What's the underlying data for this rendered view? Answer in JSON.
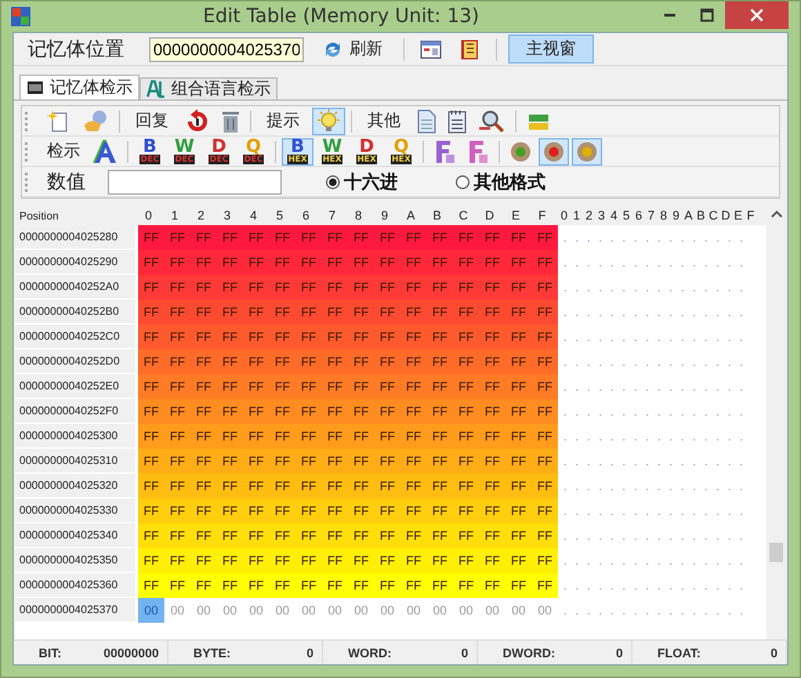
{
  "window": {
    "title": "Edit Table (Memory Unit: 13)"
  },
  "address_bar": {
    "label": "记忆体位置",
    "value": "0000000004025370",
    "refresh": "刷新",
    "main_view": {
      "label": "主视窗",
      "selected": true
    }
  },
  "tabs": [
    {
      "label": "记忆体检示",
      "selected": true
    },
    {
      "label": "组合语言检示",
      "selected": false
    }
  ],
  "toolbar_1": {
    "restore": "回复",
    "hint": "提示",
    "hint_selected": true,
    "other": "其他"
  },
  "toolbar_2": {
    "label": "检示",
    "dec_buttons": [
      {
        "letter": "B",
        "tag": "DEC",
        "color": "#3050d0",
        "selected": false
      },
      {
        "letter": "W",
        "tag": "DEC",
        "color": "#30a040",
        "selected": false
      },
      {
        "letter": "D",
        "tag": "DEC",
        "color": "#d03030",
        "selected": false
      },
      {
        "letter": "Q",
        "tag": "DEC",
        "color": "#e0a000",
        "selected": false
      }
    ],
    "hex_buttons": [
      {
        "letter": "B",
        "tag": "HEX",
        "color": "#3050d0",
        "selected": true
      },
      {
        "letter": "W",
        "tag": "HEX",
        "color": "#30a040",
        "selected": false
      },
      {
        "letter": "D",
        "tag": "HEX",
        "color": "#d03030",
        "selected": false
      },
      {
        "letter": "Q",
        "tag": "HEX",
        "color": "#e0a000",
        "selected": false
      }
    ],
    "lights": [
      {
        "color": "#40a020",
        "selected": false
      },
      {
        "color": "#e02020",
        "selected": true
      },
      {
        "color": "#e0b000",
        "selected": true
      }
    ]
  },
  "value_row": {
    "label": "数值",
    "radios": [
      {
        "label": "十六进",
        "selected": true
      },
      {
        "label": "其他格式",
        "selected": false
      }
    ]
  },
  "grid": {
    "position_header": "Position",
    "hex_headers": [
      "0",
      "1",
      "2",
      "3",
      "4",
      "5",
      "6",
      "7",
      "8",
      "9",
      "A",
      "B",
      "C",
      "D",
      "E",
      "F"
    ],
    "ascii_headers": [
      "0",
      "1",
      "2",
      "3",
      "4",
      "5",
      "6",
      "7",
      "8",
      "9",
      "A",
      "B",
      "C",
      "D",
      "E",
      "F"
    ],
    "rows": [
      {
        "address": "0000000004025280",
        "color": "#ff1840",
        "cursor_at_start": false,
        "bytes": [
          "FF",
          "FF",
          "FF",
          "FF",
          "FF",
          "FF",
          "FF",
          "FF",
          "FF",
          "FF",
          "FF",
          "FF",
          "FF",
          "FF",
          "FF",
          "FF"
        ],
        "ascii": "................"
      },
      {
        "address": "0000000004025290",
        "color": "#ff283b",
        "cursor_at_start": false,
        "bytes": [
          "FF",
          "FF",
          "FF",
          "FF",
          "FF",
          "FF",
          "FF",
          "FF",
          "FF",
          "FF",
          "FF",
          "FF",
          "FF",
          "FF",
          "FF",
          "FF"
        ],
        "ascii": "................"
      },
      {
        "address": "00000000040252A0",
        "color": "#ff3937",
        "cursor_at_start": false,
        "bytes": [
          "FF",
          "FF",
          "FF",
          "FF",
          "FF",
          "FF",
          "FF",
          "FF",
          "FF",
          "FF",
          "FF",
          "FF",
          "FF",
          "FF",
          "FF",
          "FF"
        ],
        "ascii": "................"
      },
      {
        "address": "00000000040252B0",
        "color": "#ff4a32",
        "cursor_at_start": false,
        "bytes": [
          "FF",
          "FF",
          "FF",
          "FF",
          "FF",
          "FF",
          "FF",
          "FF",
          "FF",
          "FF",
          "FF",
          "FF",
          "FF",
          "FF",
          "FF",
          "FF"
        ],
        "ascii": "................"
      },
      {
        "address": "00000000040252C0",
        "color": "#ff5a2e",
        "cursor_at_start": false,
        "bytes": [
          "FF",
          "FF",
          "FF",
          "FF",
          "FF",
          "FF",
          "FF",
          "FF",
          "FF",
          "FF",
          "FF",
          "FF",
          "FF",
          "FF",
          "FF",
          "FF"
        ],
        "ascii": "................"
      },
      {
        "address": "00000000040252D0",
        "color": "#ff6b29",
        "cursor_at_start": false,
        "bytes": [
          "FF",
          "FF",
          "FF",
          "FF",
          "FF",
          "FF",
          "FF",
          "FF",
          "FF",
          "FF",
          "FF",
          "FF",
          "FF",
          "FF",
          "FF",
          "FF"
        ],
        "ascii": "................"
      },
      {
        "address": "00000000040252E0",
        "color": "#ff7b25",
        "cursor_at_start": false,
        "bytes": [
          "FF",
          "FF",
          "FF",
          "FF",
          "FF",
          "FF",
          "FF",
          "FF",
          "FF",
          "FF",
          "FF",
          "FF",
          "FF",
          "FF",
          "FF",
          "FF"
        ],
        "ascii": "................"
      },
      {
        "address": "00000000040252F0",
        "color": "#ff8c20",
        "cursor_at_start": false,
        "bytes": [
          "FF",
          "FF",
          "FF",
          "FF",
          "FF",
          "FF",
          "FF",
          "FF",
          "FF",
          "FF",
          "FF",
          "FF",
          "FF",
          "FF",
          "FF",
          "FF"
        ],
        "ascii": "................"
      },
      {
        "address": "0000000004025300",
        "color": "#ff9c1b",
        "cursor_at_start": false,
        "bytes": [
          "FF",
          "FF",
          "FF",
          "FF",
          "FF",
          "FF",
          "FF",
          "FF",
          "FF",
          "FF",
          "FF",
          "FF",
          "FF",
          "FF",
          "FF",
          "FF"
        ],
        "ascii": "................"
      },
      {
        "address": "0000000004025310",
        "color": "#ffad17",
        "cursor_at_start": false,
        "bytes": [
          "FF",
          "FF",
          "FF",
          "FF",
          "FF",
          "FF",
          "FF",
          "FF",
          "FF",
          "FF",
          "FF",
          "FF",
          "FF",
          "FF",
          "FF",
          "FF"
        ],
        "ascii": "................"
      },
      {
        "address": "0000000004025320",
        "color": "#ffbd12",
        "cursor_at_start": false,
        "bytes": [
          "FF",
          "FF",
          "FF",
          "FF",
          "FF",
          "FF",
          "FF",
          "FF",
          "FF",
          "FF",
          "FF",
          "FF",
          "FF",
          "FF",
          "FF",
          "FF"
        ],
        "ascii": "................"
      },
      {
        "address": "0000000004025330",
        "color": "#ffce0e",
        "cursor_at_start": false,
        "bytes": [
          "FF",
          "FF",
          "FF",
          "FF",
          "FF",
          "FF",
          "FF",
          "FF",
          "FF",
          "FF",
          "FF",
          "FF",
          "FF",
          "FF",
          "FF",
          "FF"
        ],
        "ascii": "................"
      },
      {
        "address": "0000000004025340",
        "color": "#ffde09",
        "cursor_at_start": false,
        "bytes": [
          "FF",
          "FF",
          "FF",
          "FF",
          "FF",
          "FF",
          "FF",
          "FF",
          "FF",
          "FF",
          "FF",
          "FF",
          "FF",
          "FF",
          "FF",
          "FF"
        ],
        "ascii": "................"
      },
      {
        "address": "0000000004025350",
        "color": "#ffef05",
        "cursor_at_start": false,
        "bytes": [
          "FF",
          "FF",
          "FF",
          "FF",
          "FF",
          "FF",
          "FF",
          "FF",
          "FF",
          "FF",
          "FF",
          "FF",
          "FF",
          "FF",
          "FF",
          "FF"
        ],
        "ascii": "................"
      },
      {
        "address": "0000000004025360",
        "color": "#ffff00",
        "cursor_at_start": false,
        "bytes": [
          "FF",
          "FF",
          "FF",
          "FF",
          "FF",
          "FF",
          "FF",
          "FF",
          "FF",
          "FF",
          "FF",
          "FF",
          "FF",
          "FF",
          "FF",
          "FF"
        ],
        "ascii": "................"
      },
      {
        "address": "0000000004025370",
        "cursor_at_start": true,
        "bytes": [
          "00",
          "00",
          "00",
          "00",
          "00",
          "00",
          "00",
          "00",
          "00",
          "00",
          "00",
          "00",
          "00",
          "00",
          "00",
          "00"
        ],
        "ascii": "................"
      }
    ]
  },
  "status_bar": [
    {
      "label": "BIT:",
      "value": "00000000"
    },
    {
      "label": "BYTE:",
      "value": "0"
    },
    {
      "label": "WORD:",
      "value": "0"
    },
    {
      "label": "DWORD:",
      "value": "0"
    },
    {
      "label": "FLOAT:",
      "value": "0"
    }
  ]
}
